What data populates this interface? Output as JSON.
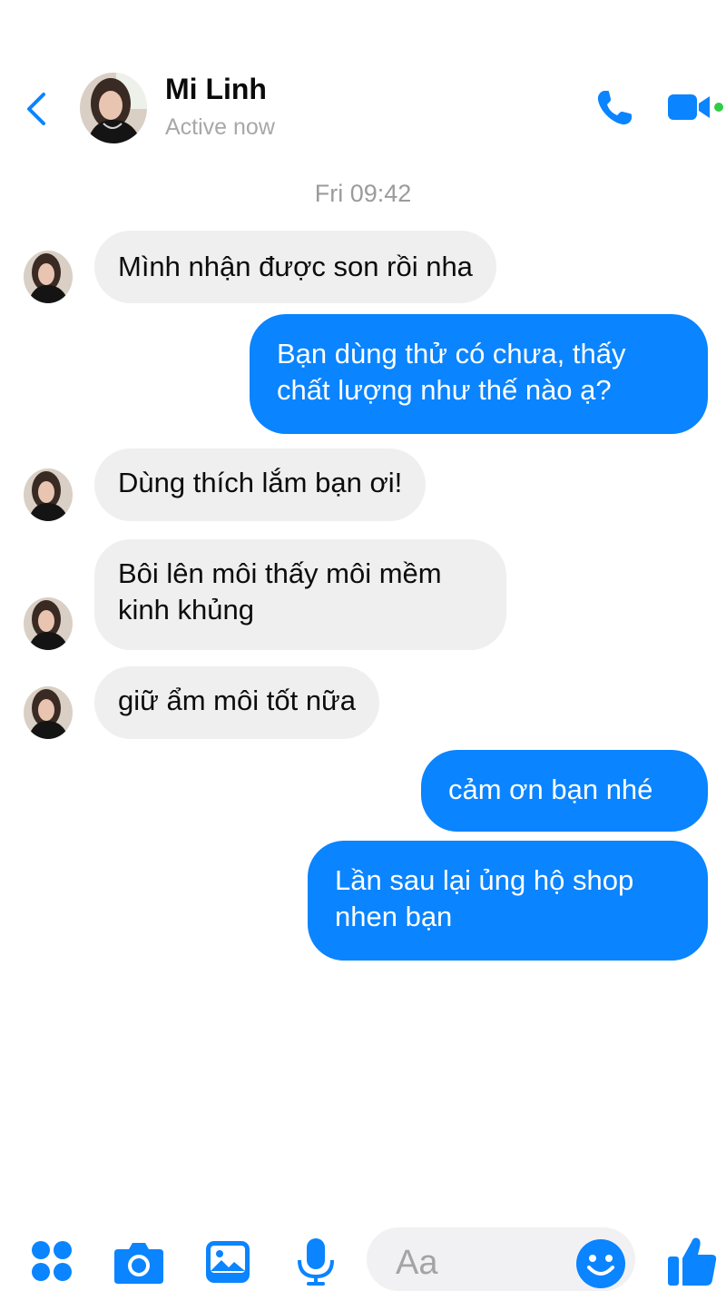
{
  "header": {
    "contact_name": "Mi Linh",
    "status": "Active now",
    "back_icon": "chevron-left-icon",
    "call_icon": "phone-icon",
    "video_icon": "video-camera-icon",
    "accent_color": "#0a84ff",
    "online_color": "#31cc46"
  },
  "timestamp": "Fri 09:42",
  "messages": [
    {
      "direction": "incoming",
      "lines": [
        "Mình nhận được son rồi nha"
      ]
    },
    {
      "direction": "outgoing",
      "lines": [
        "Bạn dùng thử có chưa, thấy",
        "chất lượng như thế nào ạ?"
      ]
    },
    {
      "direction": "incoming",
      "lines": [
        "Dùng thích lắm bạn ơi!"
      ]
    },
    {
      "direction": "incoming",
      "lines": [
        "Bôi lên môi thấy môi mềm",
        "kinh khủng"
      ]
    },
    {
      "direction": "incoming",
      "lines": [
        "giữ ẩm môi tốt nữa"
      ]
    },
    {
      "direction": "outgoing",
      "lines": [
        "cảm ơn bạn nhé"
      ]
    },
    {
      "direction": "outgoing",
      "lines": [
        "Lần sau lại ủng hộ shop",
        "nhen bạn"
      ]
    }
  ],
  "composer": {
    "placeholder": "Aa",
    "icons": [
      "apps-grid-icon",
      "camera-icon",
      "image-icon",
      "microphone-icon",
      "emoji-icon",
      "thumbs-up-icon"
    ]
  }
}
